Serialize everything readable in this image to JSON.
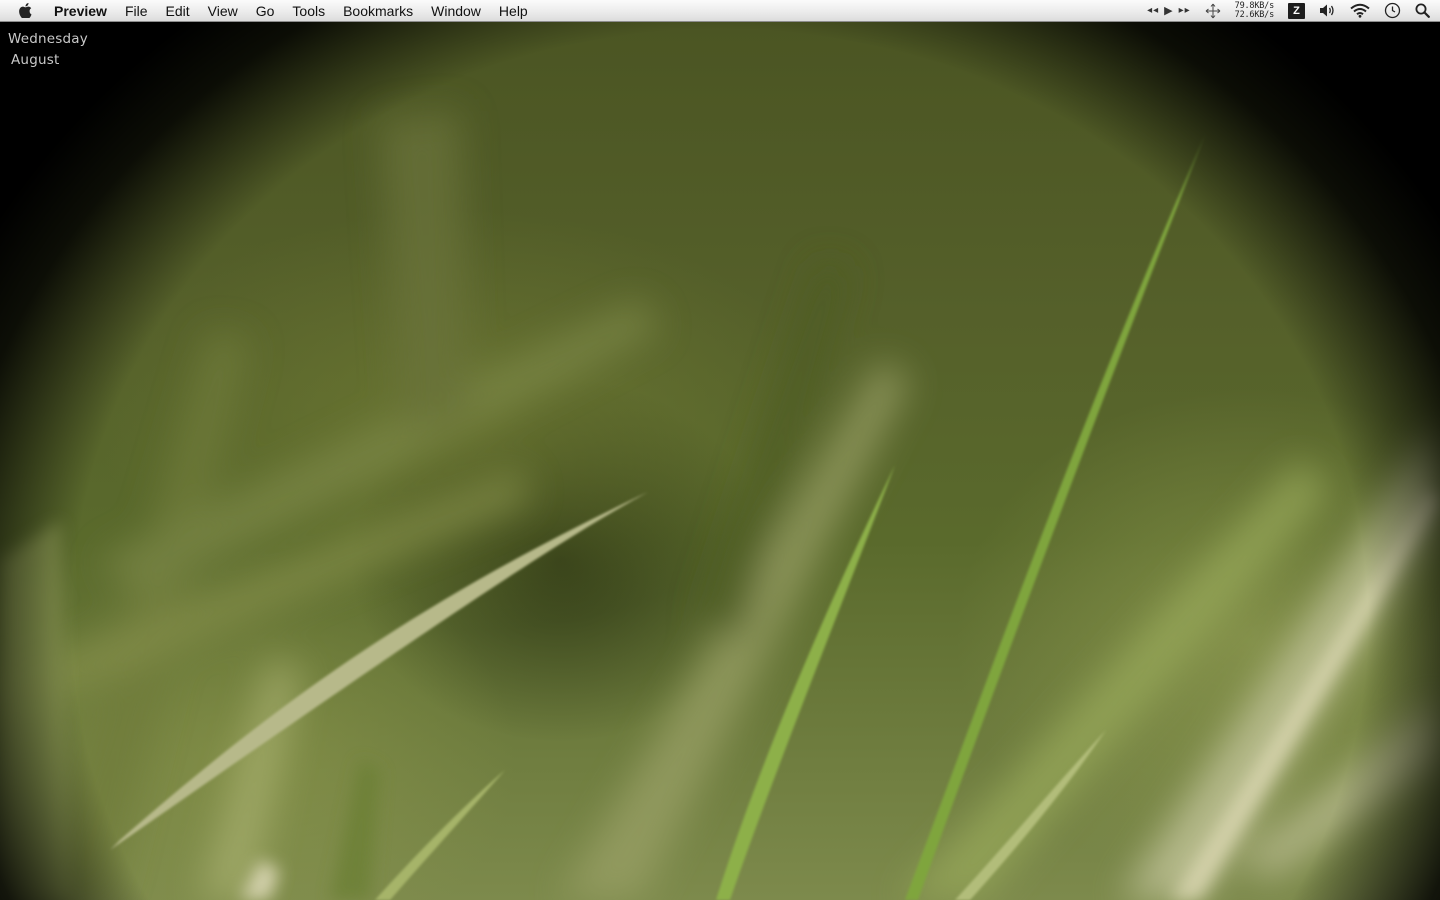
{
  "menubar": {
    "apple_icon": "apple-icon",
    "app_name": "Preview",
    "menus": [
      "File",
      "Edit",
      "View",
      "Go",
      "Tools",
      "Bookmarks",
      "Window",
      "Help"
    ],
    "status": {
      "media_icons": [
        "rewind-icon",
        "play-icon",
        "fast-forward-icon"
      ],
      "move_icon": "crosshair-move-icon",
      "download_speed": "79.8KB/s",
      "upload_speed": "72.6KB/s",
      "badge_label": "Z",
      "icons": [
        "volume-icon",
        "wifi-icon",
        "time-machine-icon",
        "spotlight-search-icon"
      ]
    }
  },
  "desktop": {
    "weekday": "Wednesday",
    "month": "August",
    "wallpaper_colors": {
      "dark": "#2f3815",
      "mid": "#5a6a2c",
      "light": "#b8bd8a",
      "blade": "#8aa34a"
    }
  }
}
